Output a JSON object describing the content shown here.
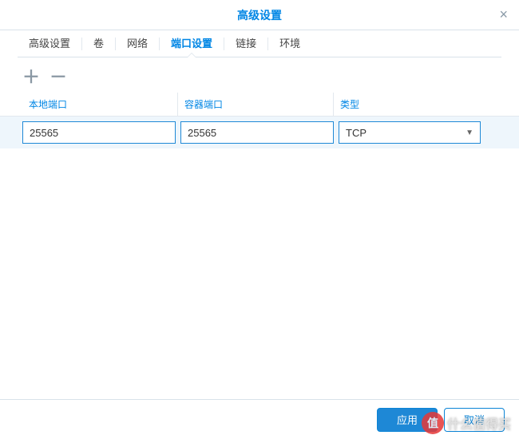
{
  "header": {
    "title": "高级设置",
    "close": "×"
  },
  "tabs": {
    "items": [
      "高级设置",
      "卷",
      "网络",
      "端口设置",
      "链接",
      "环境"
    ],
    "active_index": 3
  },
  "toolbar": {
    "add": "＋",
    "remove": "－"
  },
  "columns": {
    "local_port": "本地端口",
    "container_port": "容器端口",
    "type": "类型"
  },
  "rows": [
    {
      "local_port": "25565",
      "container_port": "25565",
      "type": "TCP"
    }
  ],
  "footer": {
    "ok": "应用",
    "cancel": "取消"
  },
  "watermark": {
    "badge": "值",
    "text": "什么值得买"
  }
}
